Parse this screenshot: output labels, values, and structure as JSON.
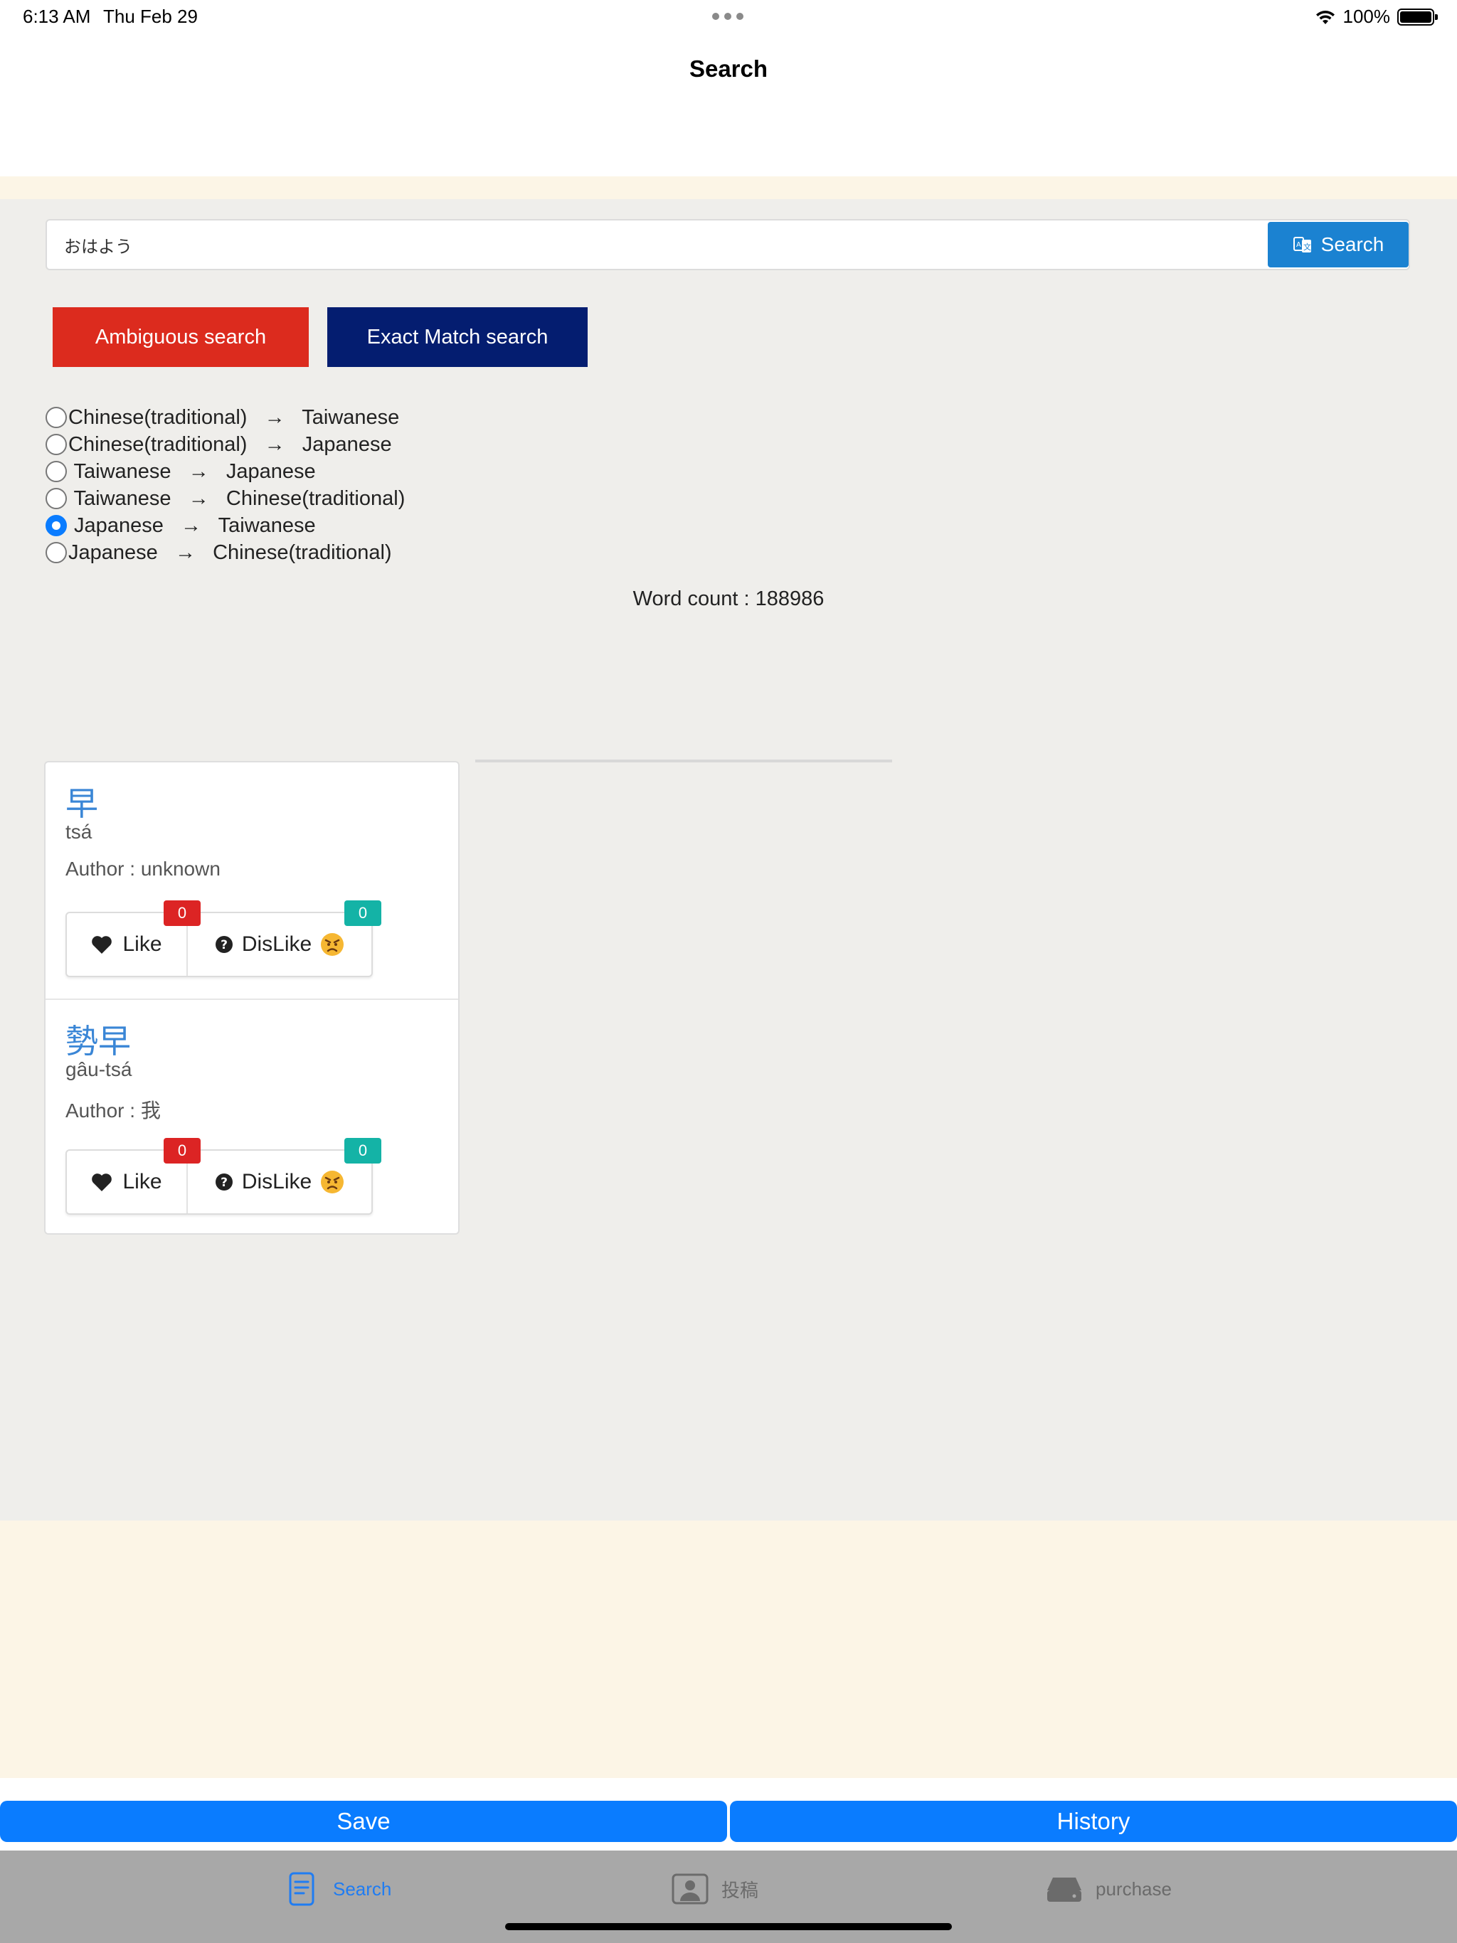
{
  "status_bar": {
    "time": "6:13 AM",
    "date": "Thu Feb 29",
    "battery": "100%"
  },
  "nav": {
    "title": "Search"
  },
  "search": {
    "query": "おはよう",
    "button_label": "Search"
  },
  "modes": {
    "ambiguous_label": "Ambiguous search",
    "exact_label": "Exact Match search"
  },
  "directions": [
    {
      "label": "Chinese(traditional)   →   Taiwanese",
      "selected": false
    },
    {
      "label": "Chinese(traditional)   →   Japanese",
      "selected": false
    },
    {
      "label": " Taiwanese   →   Japanese",
      "selected": false
    },
    {
      "label": " Taiwanese   →   Chinese(traditional)",
      "selected": false
    },
    {
      "label": " Japanese   →   Taiwanese",
      "selected": true
    },
    {
      "label": "Japanese   →   Chinese(traditional)",
      "selected": false
    }
  ],
  "word_count": "Word count : 188986",
  "results": [
    {
      "word": "早",
      "reading": "tsá",
      "author": "Author : unknown",
      "like_label": "Like",
      "dislike_label": "DisLike",
      "like_count": "0",
      "dislike_count": "0"
    },
    {
      "word": "勢早",
      "reading": "gâu-tsá",
      "author": "Author : 我",
      "like_label": "Like",
      "dislike_label": "DisLike",
      "like_count": "0",
      "dislike_count": "0"
    }
  ],
  "bottom_buttons": {
    "save": "Save",
    "history": "History"
  },
  "tabs": [
    {
      "label": "Search",
      "icon": "document-icon",
      "active": true
    },
    {
      "label": "投稿",
      "icon": "portrait-icon",
      "active": false
    },
    {
      "label": "purchase",
      "icon": "drive-icon",
      "active": false
    }
  ],
  "colors": {
    "accent": "#0a7cff",
    "search_button": "#1b82d1",
    "ambiguous": "#dc2b1e",
    "exact": "#041d70",
    "like_badge": "#dc2424",
    "dislike_badge": "#14b3a6",
    "background": "#efeeeb",
    "cream": "#fcf5e6"
  }
}
